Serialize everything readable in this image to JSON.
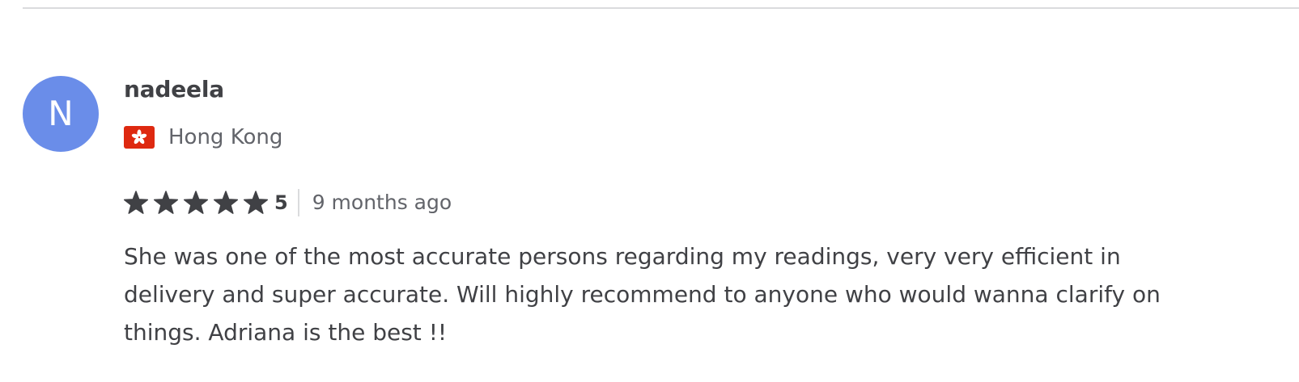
{
  "review": {
    "avatar_initial": "N",
    "avatar_color": "#6a8de9",
    "username": "nadeela",
    "country": {
      "name": "Hong Kong",
      "flag_icon": "hong-kong-flag-icon",
      "flag_color": "#de2910"
    },
    "rating": {
      "stars": 5,
      "max_stars": 5,
      "value_label": "5",
      "star_icon": "star-icon",
      "star_color": "#404145"
    },
    "time_ago": "9 months ago",
    "text": "She was one of the most accurate persons regarding my readings, very very efficient in delivery and super accurate. Will highly recommend to anyone who would wanna clarify on things. Adriana is the best !!"
  }
}
